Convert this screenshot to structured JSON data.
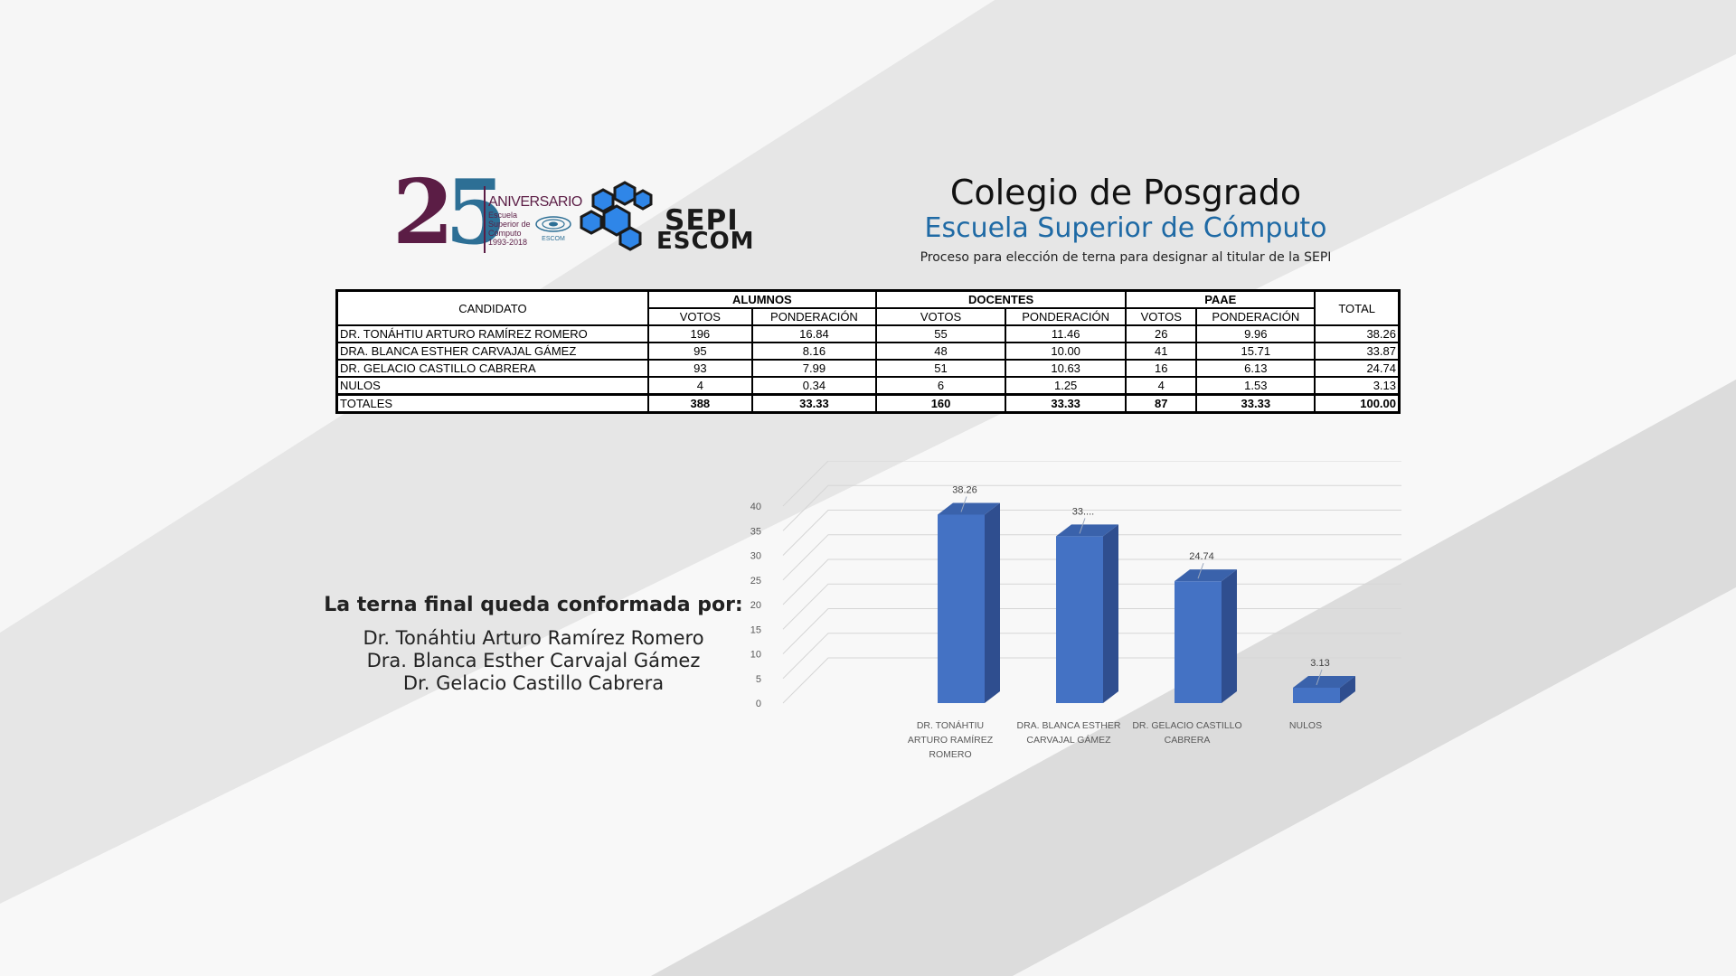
{
  "colors": {
    "bar": "#4472c4",
    "bar_side": "#2f4e8f",
    "bar_top": "#3a62ab",
    "title_blue": "#1f6aa5",
    "logo_purple": "#5b1d45",
    "logo_blue": "#2d6f95",
    "hex_blue": "#2f86e8"
  },
  "logos": {
    "aniversario": {
      "number_2": "2",
      "number_5": "5",
      "label": "ANIVERSARIO",
      "lines": [
        "Escuela",
        "Superior de",
        "Cómputo",
        "1993-2018"
      ],
      "mini": "ESCOM"
    },
    "sepi": {
      "line1": "SEPI",
      "line2": "ESCOM"
    }
  },
  "header": {
    "title": "Colegio de Posgrado",
    "subtitle": "Escuela Superior de Cómputo",
    "caption": "Proceso para elección de terna para designar al titular de la SEPI"
  },
  "table": {
    "col_candidate": "CANDIDATO",
    "groups": [
      "ALUMNOS",
      "DOCENTES",
      "PAAE"
    ],
    "col_total": "TOTAL",
    "sub": [
      "VOTOS",
      "PONDERACIÓN",
      "VOTOS",
      "PONDERACIÓN",
      "VOTOS",
      "PONDERACIÓN"
    ],
    "rows": [
      {
        "name": "DR. TONÁHTIU ARTURO RAMÍREZ ROMERO",
        "a_v": "196",
        "a_p": "16.84",
        "d_v": "55",
        "d_p": "11.46",
        "p_v": "26",
        "p_p": "9.96",
        "total": "38.26"
      },
      {
        "name": "DRA. BLANCA ESTHER CARVAJAL GÁMEZ",
        "a_v": "95",
        "a_p": "8.16",
        "d_v": "48",
        "d_p": "10.00",
        "p_v": "41",
        "p_p": "15.71",
        "total": "33.87"
      },
      {
        "name": "DR. GELACIO CASTILLO CABRERA",
        "a_v": "93",
        "a_p": "7.99",
        "d_v": "51",
        "d_p": "10.63",
        "p_v": "16",
        "p_p": "6.13",
        "total": "24.74"
      },
      {
        "name": "NULOS",
        "a_v": "4",
        "a_p": "0.34",
        "d_v": "6",
        "d_p": "1.25",
        "p_v": "4",
        "p_p": "1.53",
        "total": "3.13"
      }
    ],
    "totals": {
      "name": "TOTALES",
      "a_v": "388",
      "a_p": "33.33",
      "d_v": "160",
      "d_p": "33.33",
      "p_v": "87",
      "p_p": "33.33",
      "total": "100.00"
    }
  },
  "terna": {
    "heading": "La terna final queda conformada por:",
    "names": [
      "Dr. Tonáhtiu Arturo Ramírez Romero",
      "Dra. Blanca Esther Carvajal Gámez",
      "Dr. Gelacio Castillo Cabrera"
    ]
  },
  "chart_data": {
    "type": "bar",
    "categories": [
      [
        "DR. TONÁHTIU",
        "ARTURO RAMÍREZ",
        "ROMERO"
      ],
      [
        "DRA. BLANCA ESTHER",
        "CARVAJAL GÁMEZ"
      ],
      [
        "DR. GELACIO CASTILLO",
        "CABRERA"
      ],
      [
        "NULOS"
      ]
    ],
    "values": [
      38.26,
      33.87,
      24.74,
      3.13
    ],
    "data_labels": [
      "38.26",
      "33....",
      "24.74",
      "3.13"
    ],
    "y_ticks": [
      "0",
      "5",
      "10",
      "15",
      "20",
      "25",
      "30",
      "35",
      "40"
    ],
    "ylim": [
      0,
      40
    ],
    "grid": true,
    "three_d": true
  }
}
